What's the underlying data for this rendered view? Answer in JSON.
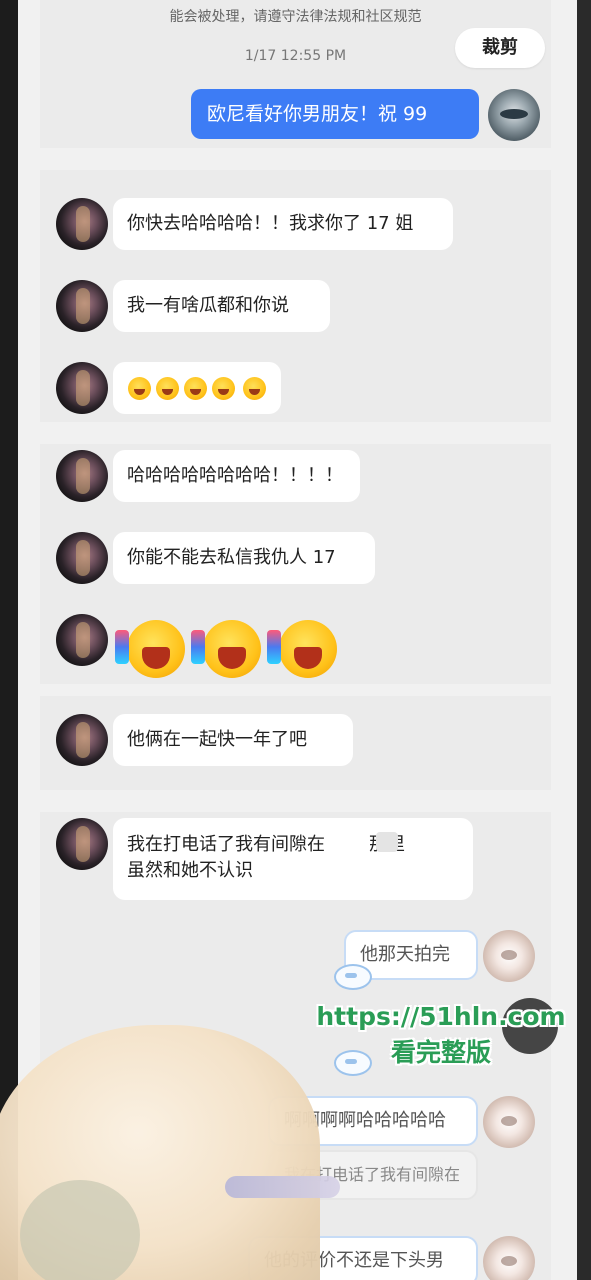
{
  "header": {
    "notice": "能会被处理，请遵守法律法规和社区规范",
    "timestamp": "1/17 12:55 PM",
    "crop_label": "裁剪"
  },
  "self_message": "欧尼看好你男朋友！祝 99",
  "group1": {
    "messages": [
      "你快去哈哈哈哈！！我求你了 17 姐",
      "我一有啥瓜都和你说"
    ],
    "emoji_row": [
      "grinning-emoji",
      "grinning-emoji",
      "grinning-emoji",
      "grinning-emoji",
      "tongue-emoji"
    ]
  },
  "group2": {
    "messages": [
      "哈哈哈哈哈哈哈哈！！！！",
      "你能不能去私信我仇人 17"
    ],
    "emoji_row": [
      "laughing-sticker",
      "laughing-sticker",
      "laughing-sticker"
    ]
  },
  "group3": {
    "messages": [
      "他俩在一起快一年了吧"
    ]
  },
  "group4": {
    "message_line1": "我在打电话了我有间隙在",
    "message_suffix": "那里",
    "message_line2": "虽然和她不认识",
    "replies": [
      "他那天拍完",
      "啊啊啊啊哈哈哈哈哈",
      "我在打电话了我有间隙在",
      "他的评价不还是下头男"
    ]
  },
  "watermark": {
    "url": "https://51hln.com",
    "subtitle": "看完整版"
  }
}
